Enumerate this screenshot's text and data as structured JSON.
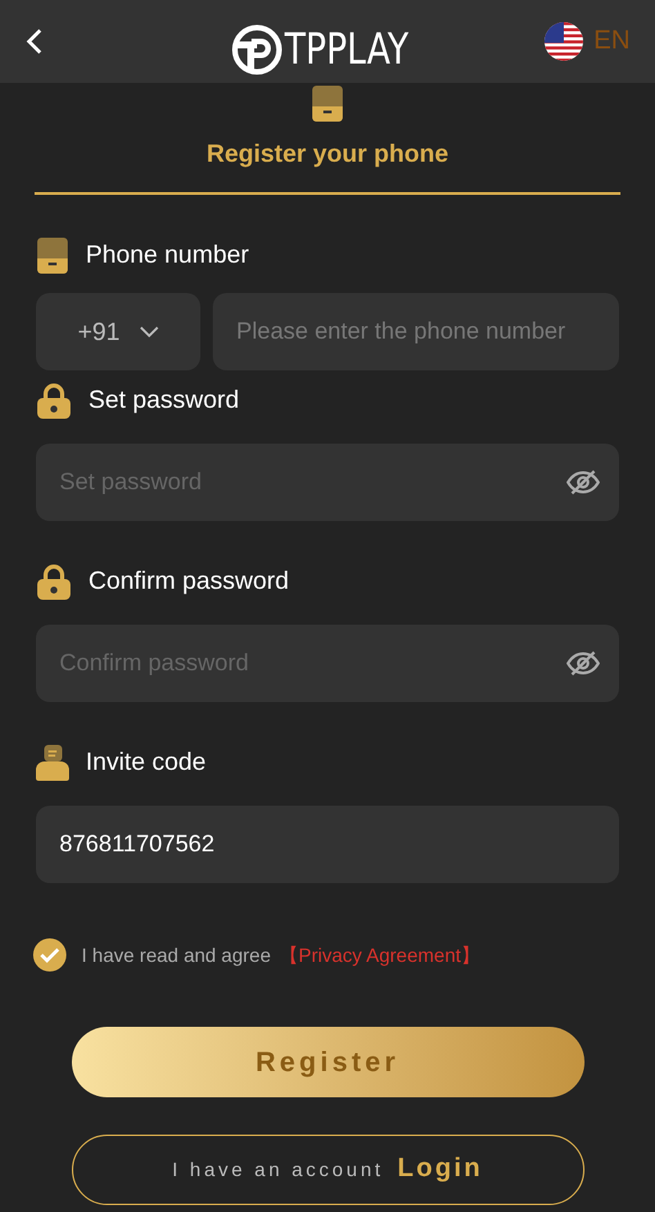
{
  "header": {
    "logo_text": "TPPLAY",
    "language": "EN"
  },
  "tab": {
    "label": "Register your phone",
    "selected": true
  },
  "fields": [
    {
      "kind": "phone",
      "label": "Phone number",
      "country_code": "+91",
      "placeholder": "Please enter the phone number"
    },
    {
      "kind": "password",
      "label": "Set password",
      "placeholder": "Set password"
    },
    {
      "kind": "password",
      "label": "Confirm password",
      "placeholder": "Confirm password"
    },
    {
      "kind": "text",
      "label": "Invite code",
      "value": "876811707562"
    }
  ],
  "agreement": {
    "checked": true,
    "text": "I have read and agree",
    "link": "【Privacy Agreement】"
  },
  "register_button": "Register",
  "login_prompt": {
    "text": "I have an account",
    "link": "Login"
  }
}
